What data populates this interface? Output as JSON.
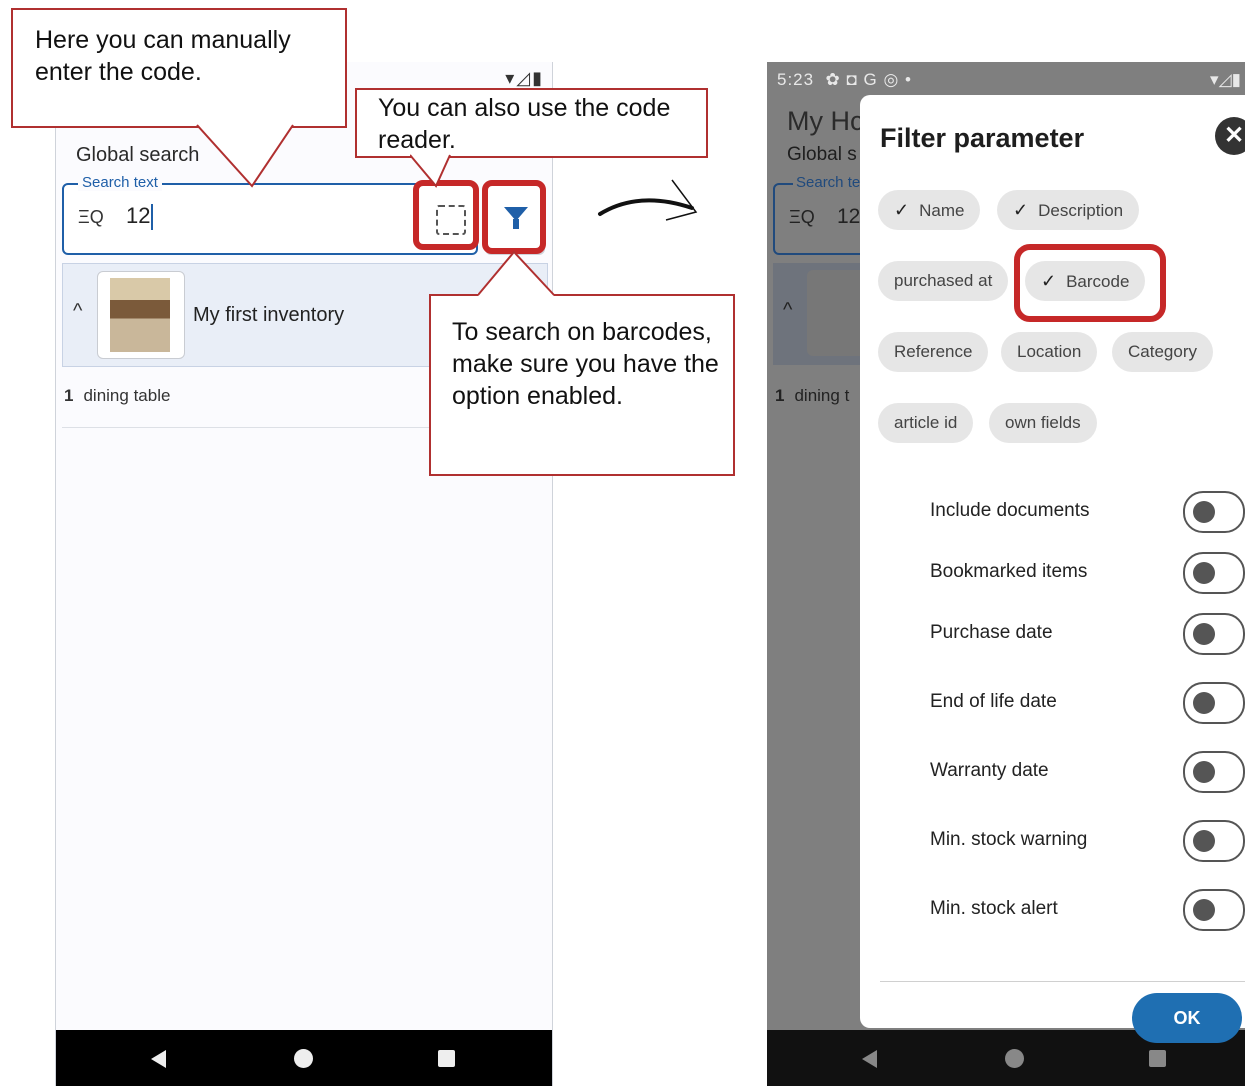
{
  "left_screen": {
    "status_icons": "▾◿▮",
    "global_search_label": "Global search",
    "search_legend": "Search text",
    "search_value": "12",
    "search_icon_glyph": "ΞQ",
    "inventory_title": "My first inventory",
    "expand_glyph": "^",
    "item_count": "1",
    "item_name": "dining table"
  },
  "callouts": {
    "manual": "Here you can manually enter the code.",
    "reader": "You can also use the code reader.",
    "barcodes": "To search on barcodes, make sure you have the option enabled."
  },
  "right_screen": {
    "status_time": "5:23",
    "status_icons_left": "✿ ◘ G ◎ •",
    "status_icons_right": "▾◿▮",
    "bg_title": "My Hc",
    "bg_global": "Global s",
    "bg_legend": "Search te",
    "bg_search_value": "12",
    "bg_item_count": "1",
    "bg_item_name": "dining t",
    "bg_expand_glyph": "^",
    "dialog": {
      "title": "Filter parameter",
      "close_glyph": "✕",
      "check_glyph": "✓",
      "chips": {
        "name": "Name",
        "description": "Description",
        "purchased_at": "purchased at",
        "barcode": "Barcode",
        "reference": "Reference",
        "location": "Location",
        "category": "Category",
        "article_id": "article id",
        "own_fields": "own fields"
      },
      "toggles": {
        "include_documents": "Include documents",
        "bookmarked_items": "Bookmarked items",
        "purchase_date": "Purchase date",
        "end_of_life_date": "End of life date",
        "warranty_date": "Warranty date",
        "min_stock_warning": "Min. stock warning",
        "min_stock_alert": "Min. stock alert"
      },
      "ok_label": "OK"
    }
  },
  "colors": {
    "accent": "#1f5fa8",
    "highlight_red": "#c62828",
    "ok_button": "#1f6fb2"
  }
}
